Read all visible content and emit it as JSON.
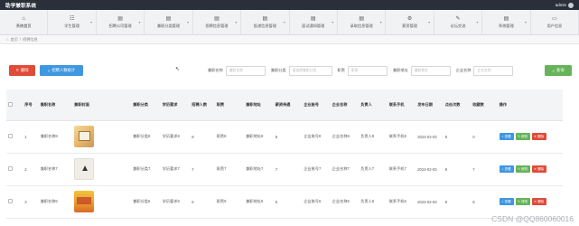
{
  "app": {
    "title": "助学兼职系统",
    "user": "admin"
  },
  "nav": [
    {
      "label": "系统首页",
      "icon": "home-icon",
      "glyph": "⌂"
    },
    {
      "label": "学生管理",
      "icon": "student-icon",
      "glyph": "☷"
    },
    {
      "label": "招聘公司管理",
      "icon": "company-icon",
      "glyph": "▤"
    },
    {
      "label": "兼职分类管理",
      "icon": "category-icon",
      "glyph": "▤"
    },
    {
      "label": "招聘信息管理",
      "icon": "recruit-info-icon",
      "glyph": "▤"
    },
    {
      "label": "投递信息管理",
      "icon": "delivery-icon",
      "glyph": "▤"
    },
    {
      "label": "面试通知管理",
      "icon": "interview-icon",
      "glyph": "▤"
    },
    {
      "label": "录取信息管理",
      "icon": "admission-icon",
      "glyph": "▤"
    },
    {
      "label": "薪资管理",
      "icon": "salary-icon",
      "glyph": "⚙"
    },
    {
      "label": "论坛交流",
      "icon": "forum-icon",
      "glyph": "✎"
    },
    {
      "label": "系统管理",
      "icon": "system-icon",
      "glyph": "▤"
    },
    {
      "label": "用户信息",
      "icon": "user-info-icon",
      "glyph": "▭"
    }
  ],
  "breadcrumb": {
    "home": "首页",
    "current": "招聘信息"
  },
  "toolbar": {
    "delete": "删除",
    "stat": "招聘人数统计",
    "filters": [
      {
        "label": "兼职名称",
        "placeholder": "兼职名称"
      },
      {
        "label": "兼职分类",
        "placeholder": "请选择兼职分类"
      },
      {
        "label": "职责",
        "placeholder": "职责"
      },
      {
        "label": "兼职地址",
        "placeholder": "兼职地址"
      },
      {
        "label": "企业名称",
        "placeholder": "企业名称"
      }
    ],
    "search": "查询"
  },
  "table": {
    "headers": [
      "",
      "序号",
      "兼职名称",
      "兼职封面",
      "兼职分类",
      "学历要求",
      "招聘人数",
      "职责",
      "兼职地址",
      "薪资待遇",
      "企业账号",
      "企业名称",
      "负责人",
      "联系手机",
      "发布日期",
      "点击次数",
      "收藏数",
      "操作"
    ],
    "rows": [
      {
        "index": "1",
        "name": "兼职名称8",
        "cover": "t1",
        "category": "兼职分类8",
        "edu": "学历要求8",
        "count": "8",
        "duty": "职责8",
        "address": "兼职地址8",
        "salary": "8",
        "account": "企业账号8",
        "company": "企业名称8",
        "contact": "负责人8",
        "phone": "联系手机8",
        "date": "2024-02-03",
        "clicks": "8",
        "favs": "0"
      },
      {
        "index": "2",
        "name": "兼职名称7",
        "cover": "t2",
        "category": "兼职分类7",
        "edu": "学历要求7",
        "count": "7",
        "duty": "职责7",
        "address": "兼职地址7",
        "salary": "7",
        "account": "企业账号7",
        "company": "企业名称7",
        "contact": "负责人7",
        "phone": "联系手机7",
        "date": "2024-02-03",
        "clicks": "8",
        "favs": "7"
      },
      {
        "index": "3",
        "name": "兼职名称6",
        "cover": "t3",
        "category": "兼职分类6",
        "edu": "学历要求6",
        "count": "6",
        "duty": "职责6",
        "address": "兼职地址6",
        "salary": "6",
        "account": "企业账号6",
        "company": "企业名称6",
        "contact": "负责人6",
        "phone": "联系手机6",
        "date": "2024-02-03",
        "clicks": "8",
        "favs": "6"
      }
    ],
    "actions": {
      "view": "查看",
      "edit": "修改",
      "delete": "删除"
    }
  },
  "watermark": "CSDN @QQ860060016"
}
